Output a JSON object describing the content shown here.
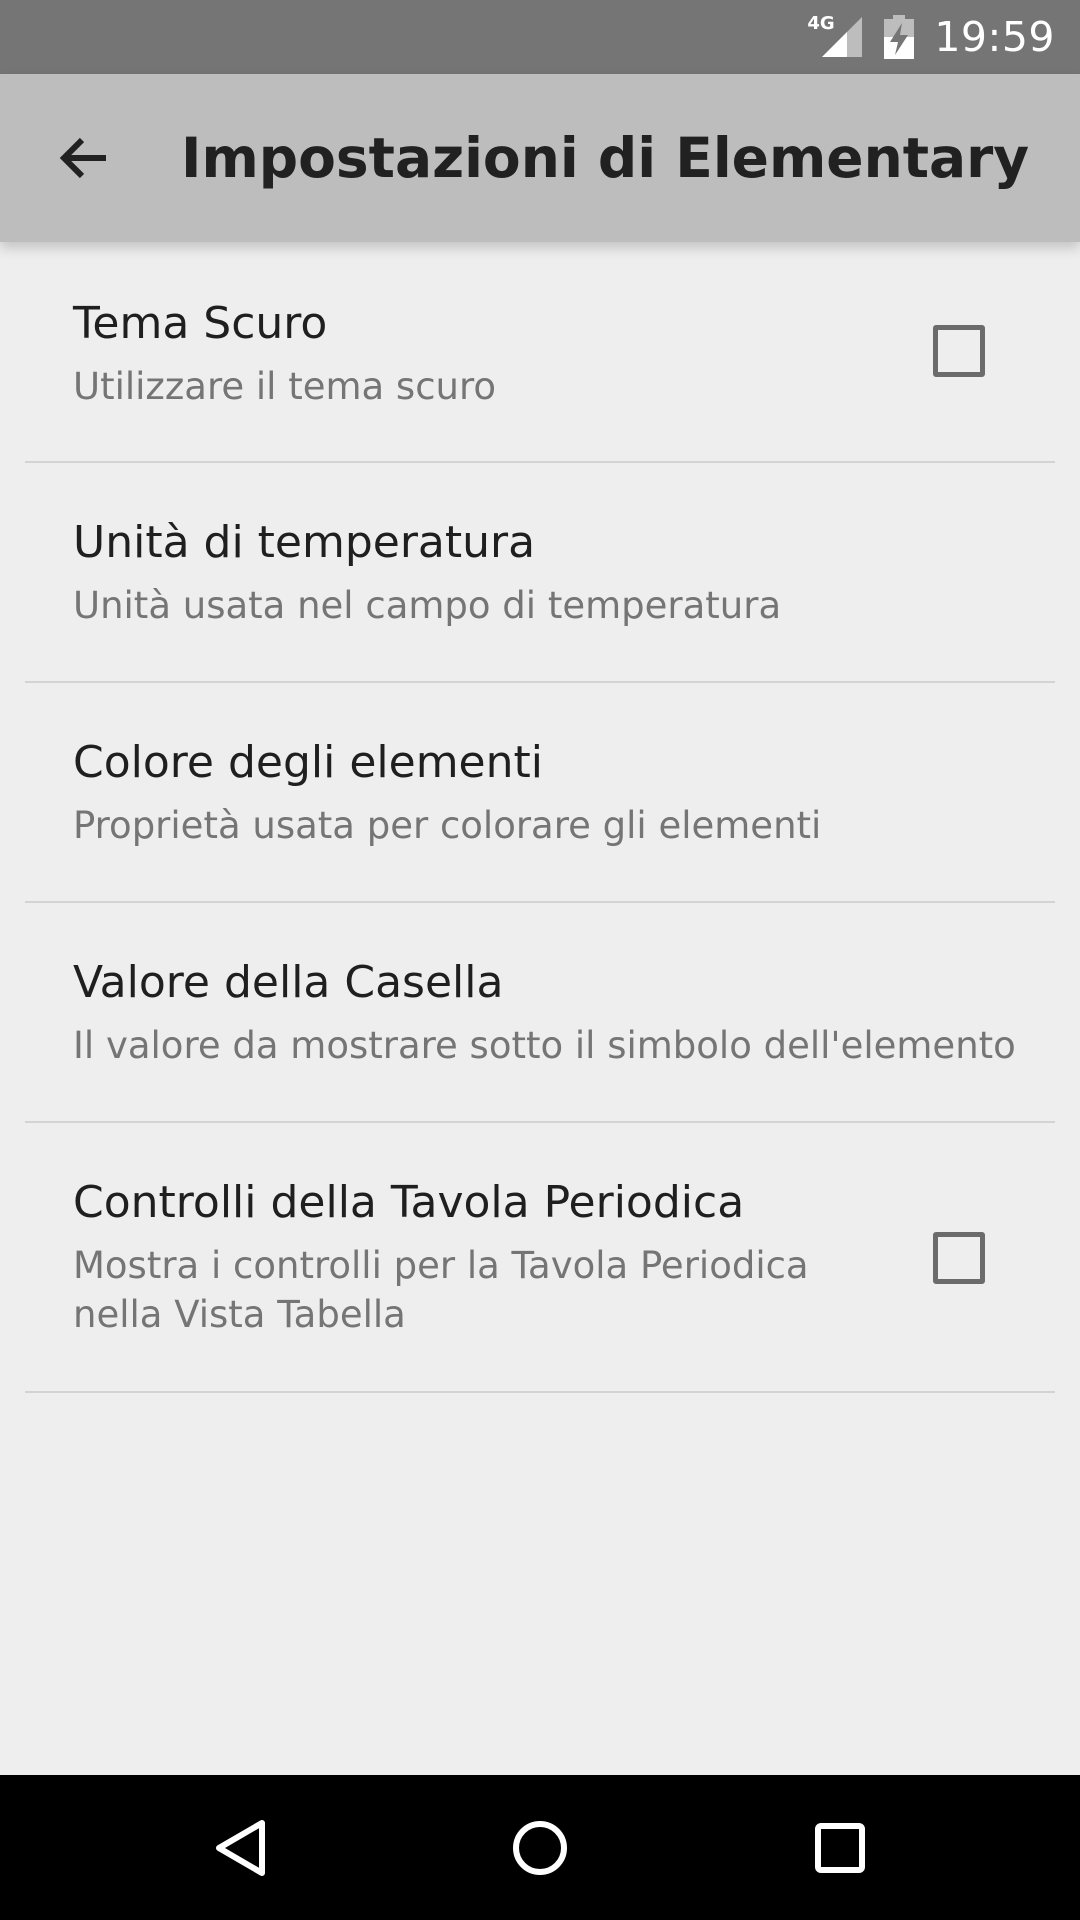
{
  "status_bar": {
    "network": "4G",
    "time": "19:59",
    "icons": [
      "signal-icon",
      "battery-charging-icon"
    ]
  },
  "app_bar": {
    "title": "Impostazioni di Elementary",
    "back_icon": "back-arrow-icon"
  },
  "preferences": [
    {
      "title": "Tema Scuro",
      "summary": "Utilizzare il tema scuro",
      "checkbox": true,
      "checked": false
    },
    {
      "title": "Unità di temperatura",
      "summary": "Unità usata nel campo di temperatura",
      "checkbox": false
    },
    {
      "title": "Colore degli elementi",
      "summary": "Proprietà usata per colorare gli elementi",
      "checkbox": false
    },
    {
      "title": "Valore della Casella",
      "summary": "Il valore da mostrare sotto il simbolo dell'elemento",
      "checkbox": false
    },
    {
      "title": "Controlli della Tavola Periodica",
      "summary": "Mostra i controlli per la Tavola Periodica nella Vista Tabella",
      "checkbox": true,
      "checked": false
    }
  ],
  "nav_bar": {
    "icons": [
      "back-triangle-icon",
      "home-circle-icon",
      "recents-square-icon"
    ]
  },
  "colors": {
    "status_bar": "#757575",
    "app_bar": "#bdbdbd",
    "background": "#eeeeee",
    "nav_bar": "#000000"
  }
}
